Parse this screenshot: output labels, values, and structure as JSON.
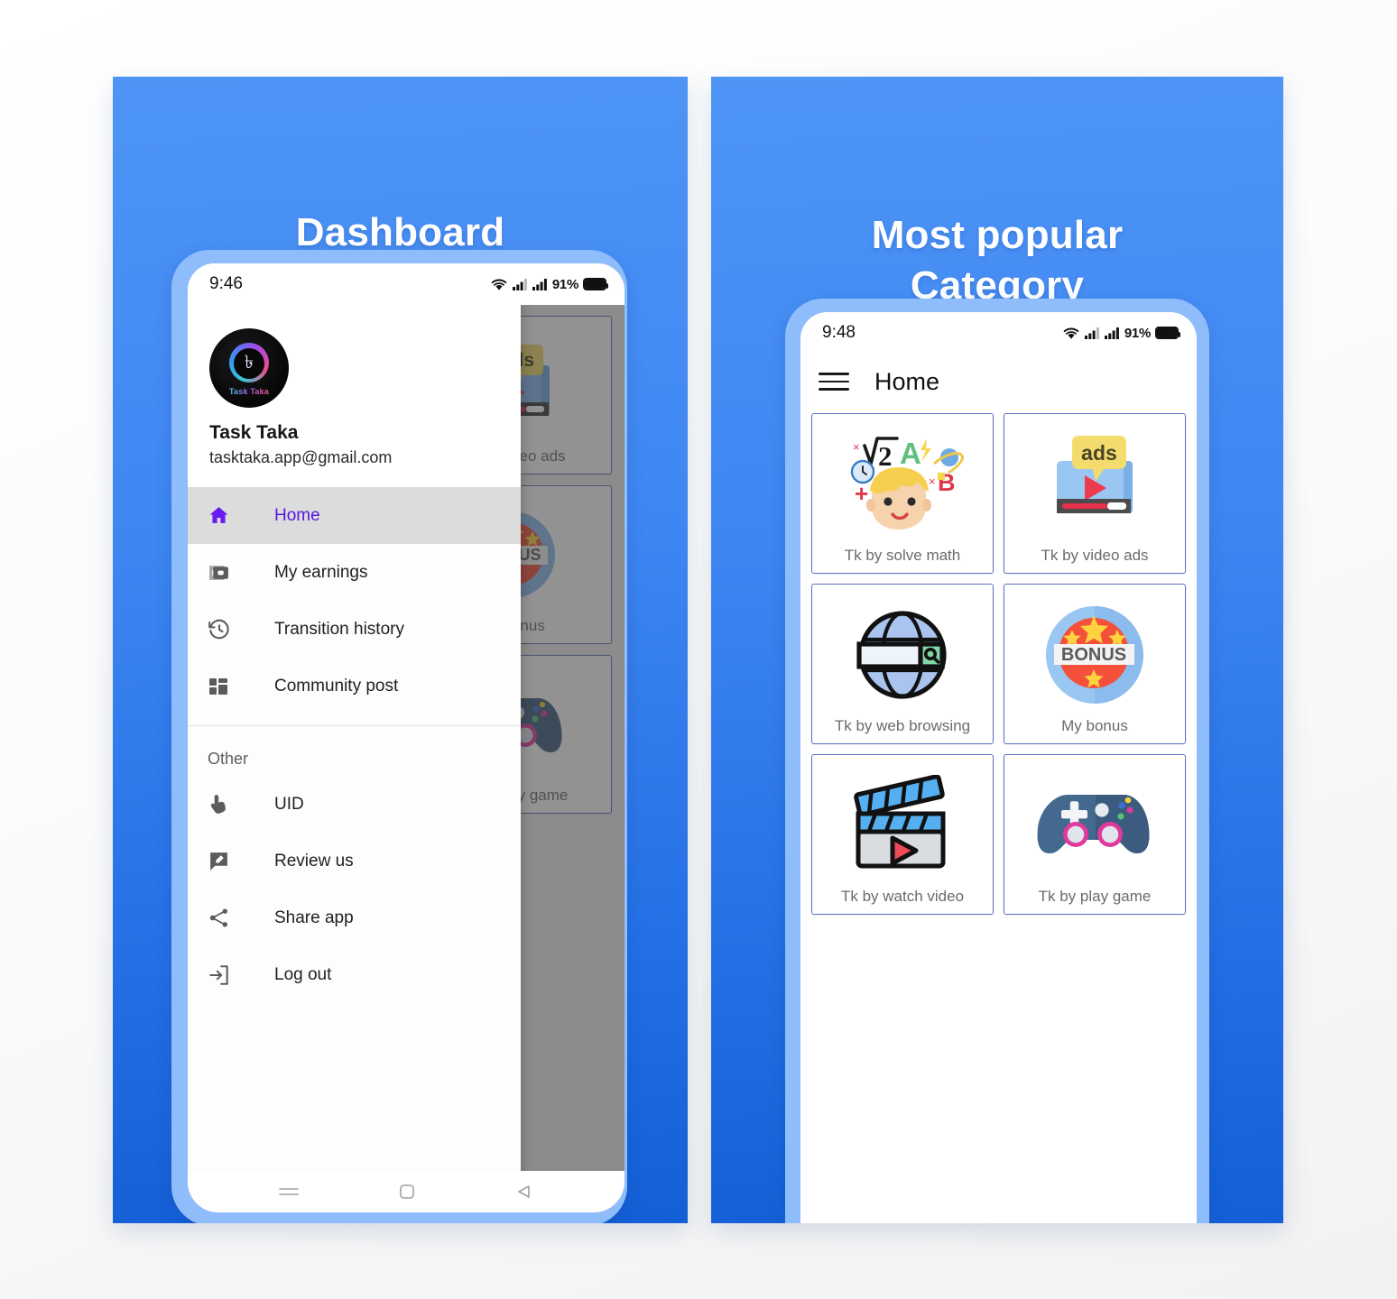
{
  "panels": [
    {
      "title": "Dashboard",
      "phone": {
        "status": {
          "time": "9:46",
          "battery_pct": "91%",
          "icons": [
            "wifi-icon",
            "signal-icon",
            "signal-icon",
            "battery-icon"
          ]
        },
        "drawer": {
          "avatar": {
            "logo_symbol": "৳",
            "logo_text": "Task Taka"
          },
          "account_name": "Task Taka",
          "account_email": "tasktaka.app@gmail.com",
          "items": [
            {
              "label": "Home",
              "icon": "home-icon",
              "active": true
            },
            {
              "label": "My earnings",
              "icon": "wallet-icon",
              "active": false
            },
            {
              "label": "Transition history",
              "icon": "history-icon",
              "active": false
            },
            {
              "label": "Community post",
              "icon": "dashboard-icon",
              "active": false
            }
          ],
          "group_label": "Other",
          "other_items": [
            {
              "label": "UID",
              "icon": "tap-finger-icon"
            },
            {
              "label": "Review us",
              "icon": "rate-review-icon"
            },
            {
              "label": "Share app",
              "icon": "share-icon"
            },
            {
              "label": "Log out",
              "icon": "logout-icon"
            }
          ]
        },
        "nav": [
          "menu-nav-icon",
          "home-nav-icon",
          "back-nav-icon"
        ]
      }
    },
    {
      "title": "Most popular\nCategory",
      "title_line1": "Most popular",
      "title_line2": "Category",
      "phone": {
        "status": {
          "time": "9:48",
          "battery_pct": "91%",
          "icons": [
            "wifi-icon",
            "signal-icon",
            "signal-icon",
            "battery-icon"
          ]
        },
        "appbar": {
          "menu_icon": "hamburger-icon",
          "title": "Home"
        },
        "grid": [
          {
            "label": "Tk by solve math",
            "icon": "math-kid-icon"
          },
          {
            "label": "Tk by video ads",
            "icon": "video-ads-icon"
          },
          {
            "label": "Tk by web browsing",
            "icon": "globe-search-icon"
          },
          {
            "label": "My bonus",
            "icon": "bonus-badge-icon"
          },
          {
            "label": "Tk by watch video",
            "icon": "clapperboard-icon"
          },
          {
            "label": "Tk by play game",
            "icon": "gamepad-icon"
          }
        ],
        "nav": [
          "menu-nav-icon",
          "home-nav-icon",
          "back-nav-icon"
        ]
      }
    }
  ],
  "colors": {
    "panel_top": "#4e95f6",
    "panel_bottom": "#145fd6",
    "phone_frame": "#8fbdfb",
    "accent_purple": "#5717e0",
    "card_border": "#5b6fc4",
    "label_gray": "#6b6b6b"
  }
}
